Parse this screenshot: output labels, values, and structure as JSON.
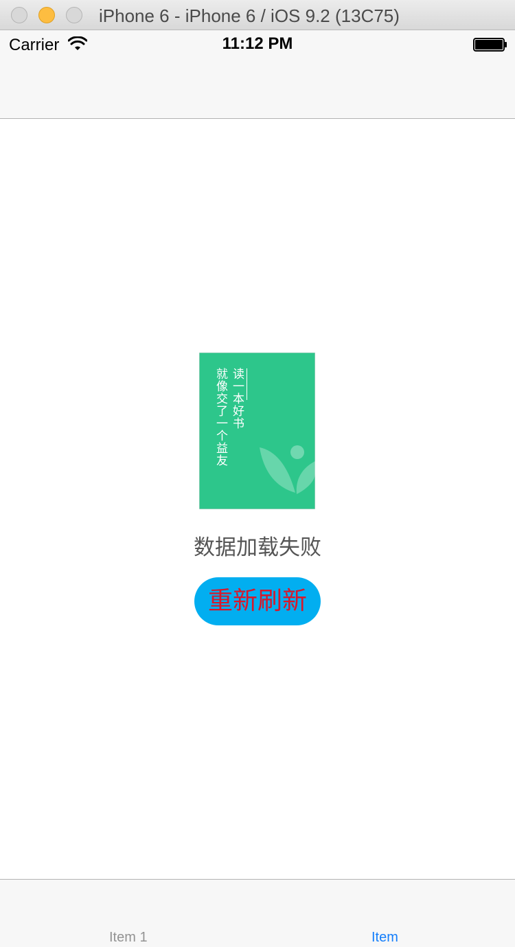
{
  "window": {
    "title": "iPhone 6 - iPhone 6 / iOS 9.2 (13C75)"
  },
  "status_bar": {
    "carrier": "Carrier",
    "time": "11:12 PM"
  },
  "book_cover": {
    "line1": "读一本好书",
    "line2": "就像交了一个益友",
    "color": "#2dc68b"
  },
  "error": {
    "message": "数据加载失败"
  },
  "refresh_button": {
    "label": "重新刷新",
    "bg_color": "#02aef0",
    "text_color": "#d8172a"
  },
  "tab_bar": {
    "items": [
      {
        "label": "Item 1"
      },
      {
        "label": "Item"
      }
    ],
    "active_color": "#147efb"
  }
}
